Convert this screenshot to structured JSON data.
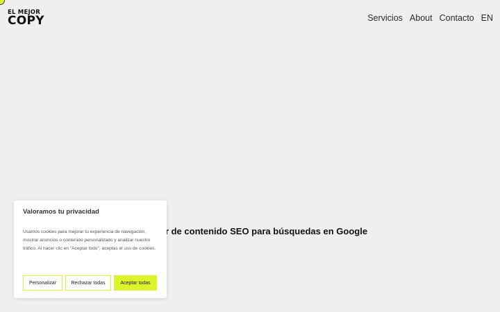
{
  "colors": {
    "accent": "#dcf52a",
    "background": "#efefef"
  },
  "logo": {
    "line1": "EL MEJOR",
    "line2": "COPY"
  },
  "nav": {
    "items": [
      "Servicios",
      "About",
      "Contacto",
      "EN"
    ]
  },
  "hero": {
    "text": "or de contenido SEO para búsquedas en Google"
  },
  "cookie_banner": {
    "title": "Valoramos tu privacidad",
    "body": "Usamos cookies para mejorar tu experiencia de navegación, mostrar anuncios o contenido personalizado y analizar nuestro tráfico. Al hacer clic en \"Aceptar todo\", aceptas el uso de cookies.",
    "buttons": {
      "customize": "Personalizar",
      "reject": "Rechazar todas",
      "accept": "Aceptar todas"
    }
  }
}
